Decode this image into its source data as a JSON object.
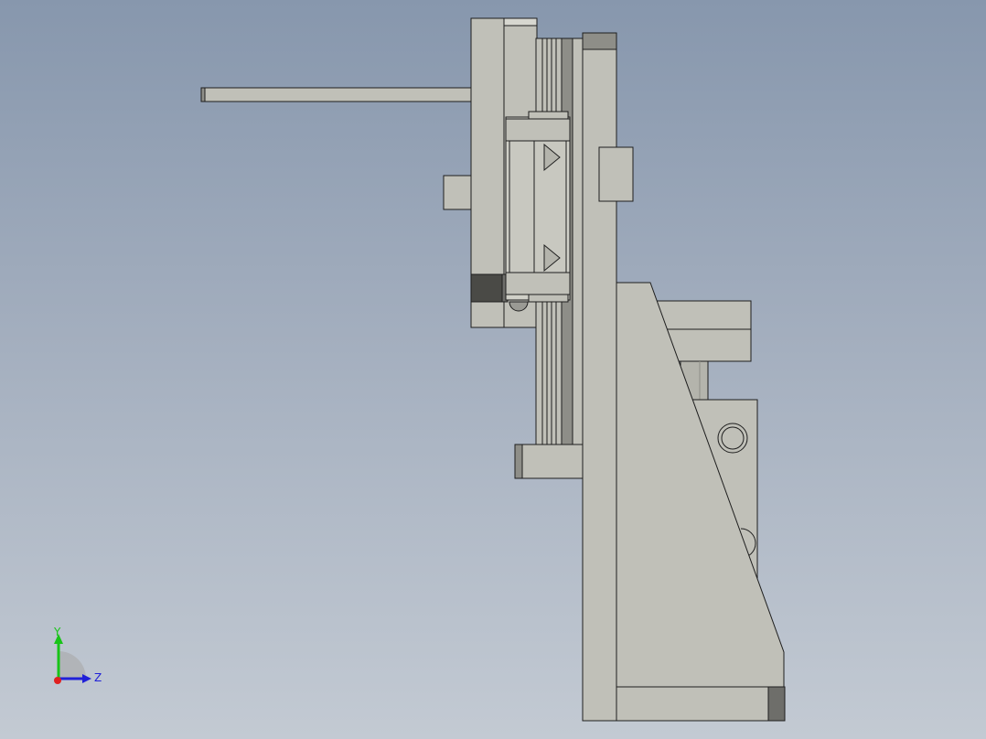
{
  "viewport": {
    "background_top": "#8797ad",
    "background_bottom": "#c3cad3"
  },
  "model": {
    "part_fill": "#c0c0b8",
    "edge_color": "#1e1e1e",
    "shadow_fill": "#6e6e6a",
    "dark_fill": "#4a4a46"
  },
  "triad": {
    "y_label": "Y",
    "z_label": "Z",
    "y_color": "#18c418",
    "z_color": "#2020d8",
    "x_color": "#e02020"
  }
}
